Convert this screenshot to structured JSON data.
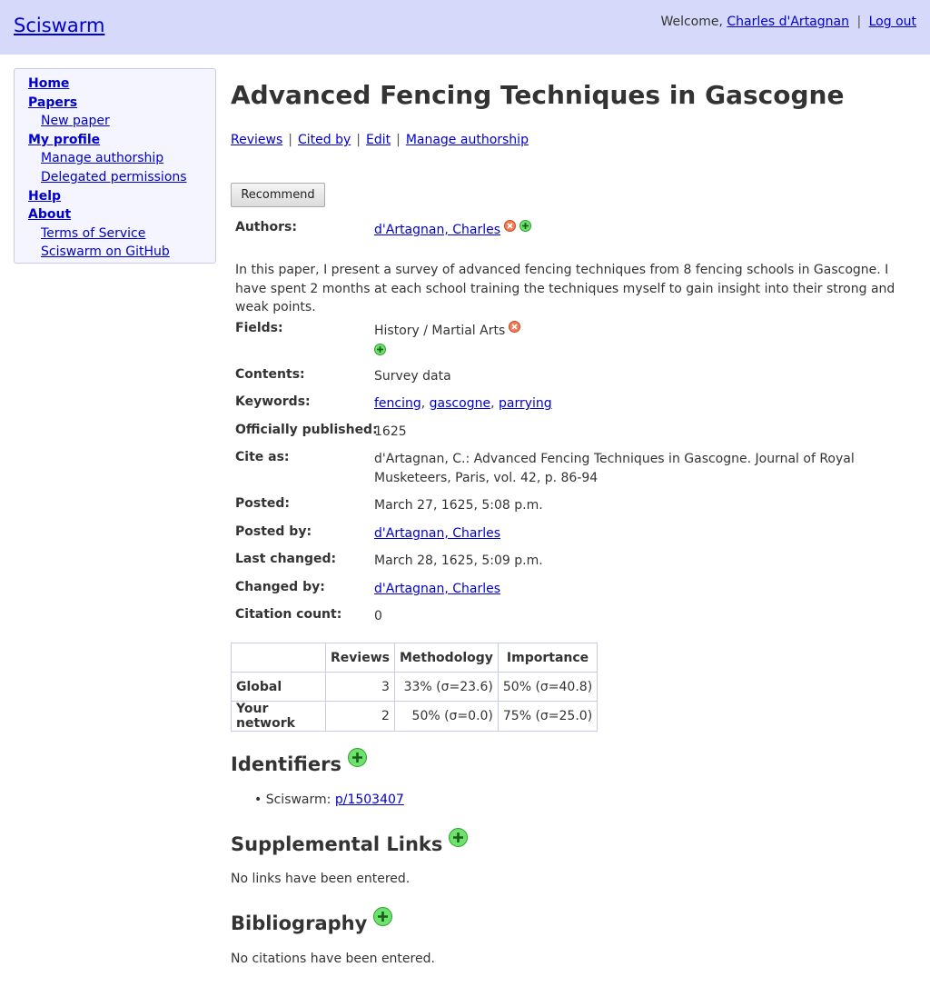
{
  "header": {
    "brand": "Sciswarm",
    "welcome": "Welcome,",
    "user": "Charles d'Artagnan",
    "separator": "|",
    "logout": "Log out"
  },
  "sidebar": {
    "home": "Home",
    "papers": "Papers",
    "new_paper": "New paper",
    "my_profile": "My profile",
    "manage_authorship": "Manage authorship",
    "delegated_permissions": "Delegated permissions",
    "help": "Help",
    "about": "About",
    "terms": "Terms of Service",
    "github": "Sciswarm on GitHub"
  },
  "paper": {
    "title": "Advanced Fencing Techniques in Gascogne",
    "tabs": [
      "Reviews",
      "Cited by",
      "Edit",
      "Manage authorship"
    ],
    "tab_sep": "|",
    "recommend": "Recommend",
    "authors_label": "Authors:",
    "author": "d'Artagnan, Charles",
    "abstract": "In this paper, I present a survey of advanced fencing techniques from 8 fencing schools in Gascogne. I have spent 2 months at each school training the techniques myself to gain insight into their strong and weak points.",
    "fields_label": "Fields:",
    "field": "History / Martial Arts",
    "contents_label": "Contents:",
    "contents": "Survey data",
    "keywords_label": "Keywords:",
    "keywords": [
      "fencing",
      "gascogne",
      "parrying"
    ],
    "kw_sep": ",",
    "published_label": "Officially published:",
    "published": "1625",
    "cite_label": "Cite as:",
    "cite": "d'Artagnan, C.: Advanced Fencing Techniques in Gascogne. Journal of Royal Musketeers, Paris, vol. 42, p. 86-94",
    "posted_label": "Posted:",
    "posted": "March 27, 1625, 5:08 p.m.",
    "posted_by_label": "Posted by:",
    "posted_by": "d'Artagnan, Charles",
    "changed_label": "Last changed:",
    "changed": "March 28, 1625, 5:09 p.m.",
    "changed_by_label": "Changed by:",
    "changed_by": "d'Artagnan, Charles",
    "citation_count_label": "Citation count:",
    "citation_count": "0"
  },
  "scores": {
    "headers": [
      "",
      "Reviews",
      "Methodology",
      "Importance"
    ],
    "rows": [
      [
        "Global",
        "3",
        "33% (σ=23.6)",
        "50% (σ=40.8)"
      ],
      [
        "Your network",
        "2",
        "50% (σ=0.0)",
        "75% (σ=25.0)"
      ]
    ]
  },
  "identifiers": {
    "heading": "Identifiers",
    "item_label": "Sciswarm:",
    "item_link": "p/1503407",
    "bullet": "•"
  },
  "links": {
    "heading": "Supplemental Links",
    "empty": "No links have been entered."
  },
  "bibliography": {
    "heading": "Bibliography",
    "empty": "No citations have been entered."
  }
}
